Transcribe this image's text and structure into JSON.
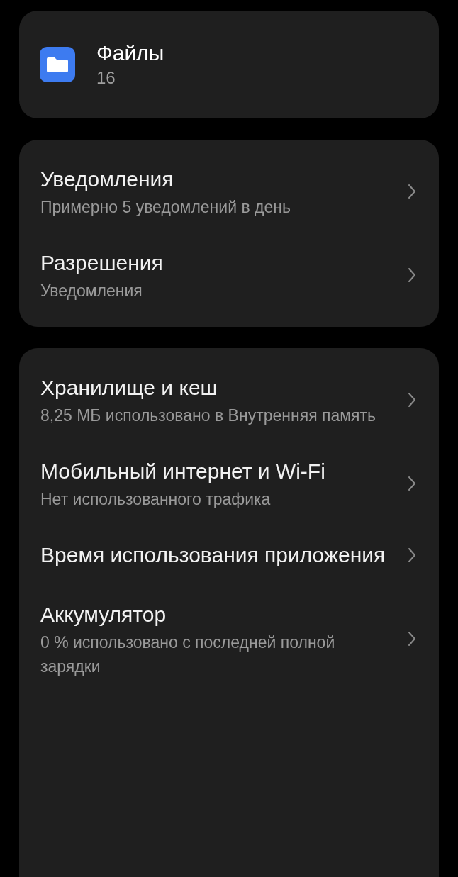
{
  "app": {
    "name": "Файлы",
    "count": "16"
  },
  "sections": [
    {
      "items": [
        {
          "title": "Уведомления",
          "subtitle": "Примерно 5 уведомлений в день"
        },
        {
          "title": "Разрешения",
          "subtitle": "Уведомления"
        }
      ]
    },
    {
      "items": [
        {
          "title": "Хранилище и кеш",
          "subtitle": "8,25 МБ использовано в Внутренняя память"
        },
        {
          "title": "Мобильный интернет и Wi-Fi",
          "subtitle": "Нет использованного трафика"
        },
        {
          "title": "Время использования приложения"
        },
        {
          "title": "Аккумулятор",
          "subtitle": "0 % использовано с последней полной зарядки"
        }
      ]
    }
  ]
}
